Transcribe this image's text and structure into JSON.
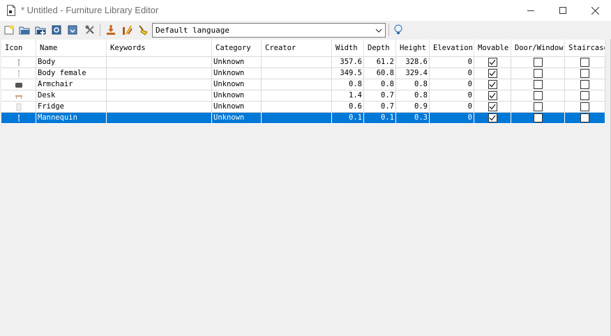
{
  "window": {
    "title": "* Untitled - Furniture Library Editor",
    "controls": [
      "minimize",
      "maximize",
      "close"
    ]
  },
  "toolbar": {
    "buttons": [
      "new-library-icon",
      "open-library-icon",
      "merge-library-icon",
      "save-library-icon",
      "save-as-library-icon",
      "preferences-icon",
      "import-furniture-icon",
      "modify-furniture-icon",
      "delete-furniture-icon"
    ],
    "language": {
      "selected": "Default language"
    },
    "help_icon": "lightbulb-icon"
  },
  "table": {
    "columns": [
      "Icon",
      "Name",
      "Keywords",
      "Category",
      "Creator",
      "Width",
      "Depth",
      "Height",
      "Elevation",
      "Movable",
      "Door/Window",
      "Staircase"
    ],
    "rows": [
      {
        "icon": "body-icon",
        "name": "Body",
        "keywords": "",
        "category": "Unknown",
        "creator": "",
        "width": "357.6",
        "depth": "61.2",
        "height": "328.6",
        "elevation": "0",
        "movable": true,
        "door_window": false,
        "staircase": false
      },
      {
        "icon": "body-female-icon",
        "name": "Body female",
        "keywords": "",
        "category": "Unknown",
        "creator": "",
        "width": "349.5",
        "depth": "60.8",
        "height": "329.4",
        "elevation": "0",
        "movable": true,
        "door_window": false,
        "staircase": false
      },
      {
        "icon": "armchair-icon",
        "name": "Armchair",
        "keywords": "",
        "category": "Unknown",
        "creator": "",
        "width": "0.8",
        "depth": "0.8",
        "height": "0.8",
        "elevation": "0",
        "movable": true,
        "door_window": false,
        "staircase": false
      },
      {
        "icon": "desk-icon",
        "name": "Desk",
        "keywords": "",
        "category": "Unknown",
        "creator": "",
        "width": "1.4",
        "depth": "0.7",
        "height": "0.8",
        "elevation": "0",
        "movable": true,
        "door_window": false,
        "staircase": false
      },
      {
        "icon": "fridge-icon",
        "name": "Fridge",
        "keywords": "",
        "category": "Unknown",
        "creator": "",
        "width": "0.6",
        "depth": "0.7",
        "height": "0.9",
        "elevation": "0",
        "movable": true,
        "door_window": false,
        "staircase": false
      },
      {
        "icon": "mannequin-icon",
        "name": "Mannequin",
        "keywords": "",
        "category": "Unknown",
        "creator": "",
        "width": "0.1",
        "depth": "0.1",
        "height": "0.3",
        "elevation": "0",
        "movable": true,
        "door_window": false,
        "staircase": false,
        "selected": true
      }
    ]
  },
  "colors": {
    "selection": "#0078d7",
    "background": "#f0f0f0"
  }
}
